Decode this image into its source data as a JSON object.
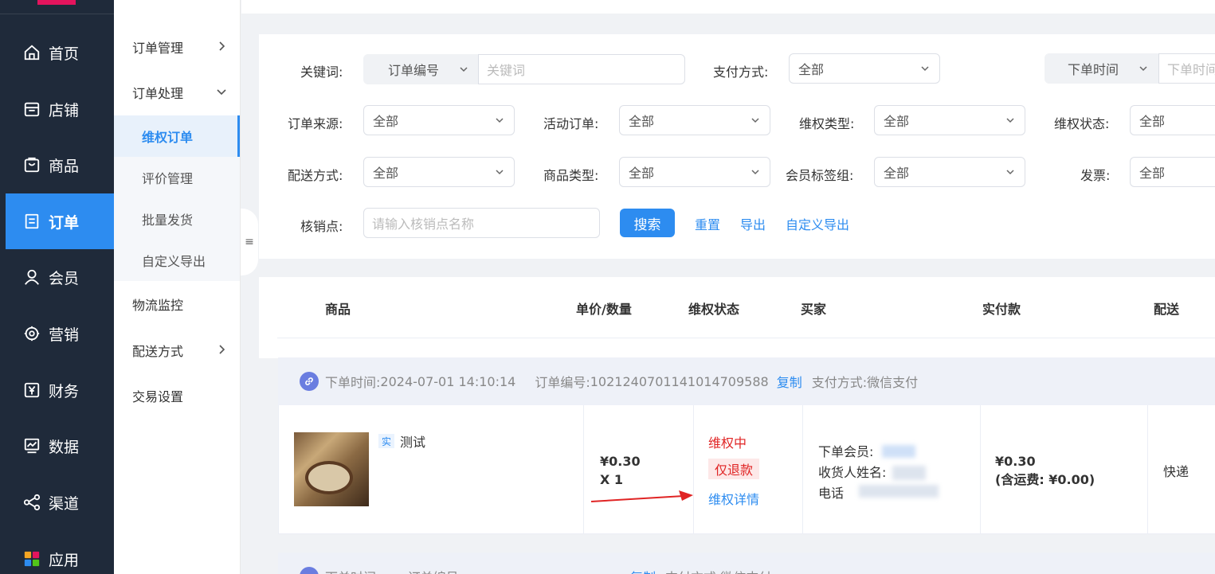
{
  "sidebar": {
    "items": [
      {
        "label": "首页",
        "icon": "home-icon"
      },
      {
        "label": "店铺",
        "icon": "store-icon"
      },
      {
        "label": "商品",
        "icon": "product-icon"
      },
      {
        "label": "订单",
        "icon": "order-icon",
        "active": true
      },
      {
        "label": "会员",
        "icon": "user-icon"
      },
      {
        "label": "营销",
        "icon": "marketing-icon"
      },
      {
        "label": "财务",
        "icon": "yen-icon"
      },
      {
        "label": "数据",
        "icon": "chart-icon"
      },
      {
        "label": "渠道",
        "icon": "share-icon"
      },
      {
        "label": "应用",
        "icon": "apps-icon"
      }
    ],
    "accent": "#2d8cf0",
    "background": "#1f2a3a"
  },
  "submenu": {
    "order_manage": "订单管理",
    "order_process": "订单处理",
    "children": [
      "维权订单",
      "评价管理",
      "批量发货",
      "自定义导出"
    ],
    "logistics": "物流监控",
    "delivery": "配送方式",
    "trade_settings": "交易设置"
  },
  "filters": {
    "keyword_label": "关键词:",
    "keyword_type": "订单编号",
    "keyword_placeholder": "关键词",
    "pay_label": "支付方式:",
    "pay_value": "全部",
    "time_type": "下单时间",
    "time_placeholder": "下单时间",
    "source_label": "订单来源:",
    "source_value": "全部",
    "activity_label": "活动订单:",
    "activity_value": "全部",
    "rights_type_label": "维权类型:",
    "rights_type_value": "全部",
    "rights_status_label": "维权状态:",
    "rights_status_value": "全部",
    "delivery_label": "配送方式:",
    "delivery_value": "全部",
    "goods_type_label": "商品类型:",
    "goods_type_value": "全部",
    "member_tag_label": "会员标签组:",
    "member_tag_value": "全部",
    "invoice_label": "发票:",
    "invoice_value": "全部",
    "verify_label": "核销点:",
    "verify_placeholder": "请输入核销点名称",
    "search_btn": "搜索",
    "reset_btn": "重置",
    "export_btn": "导出",
    "custom_export_btn": "自定义导出"
  },
  "table": {
    "headers": [
      "商品",
      "单价/数量",
      "维权状态",
      "买家",
      "实付款",
      "配送"
    ]
  },
  "order": {
    "time_label": "下单时间:",
    "time": "2024-07-01 14:10:14",
    "no_label": "订单编号:",
    "no": "10212407011410147095 88",
    "copy": "复制",
    "pay_label": "支付方式:",
    "pay": "微信支付",
    "goods_badge": "实",
    "goods_name": "测试",
    "price": "¥0.30",
    "qty": "X 1",
    "rights_status": "维权中",
    "refund_tag": "仅退款",
    "rights_detail": "维权详情",
    "buyer_member": "下单会员:",
    "buyer_name": "收货人姓名:",
    "buyer_phone": "电话",
    "paid": "¥0.30",
    "freight": "(含运费: ¥0.00)",
    "ship": "快递"
  },
  "order2": {
    "time_label": "下单时间:",
    "no_label": "订单编号:",
    "copy": "复制",
    "pay_label": "支付方式:",
    "pay": "微信支付"
  }
}
